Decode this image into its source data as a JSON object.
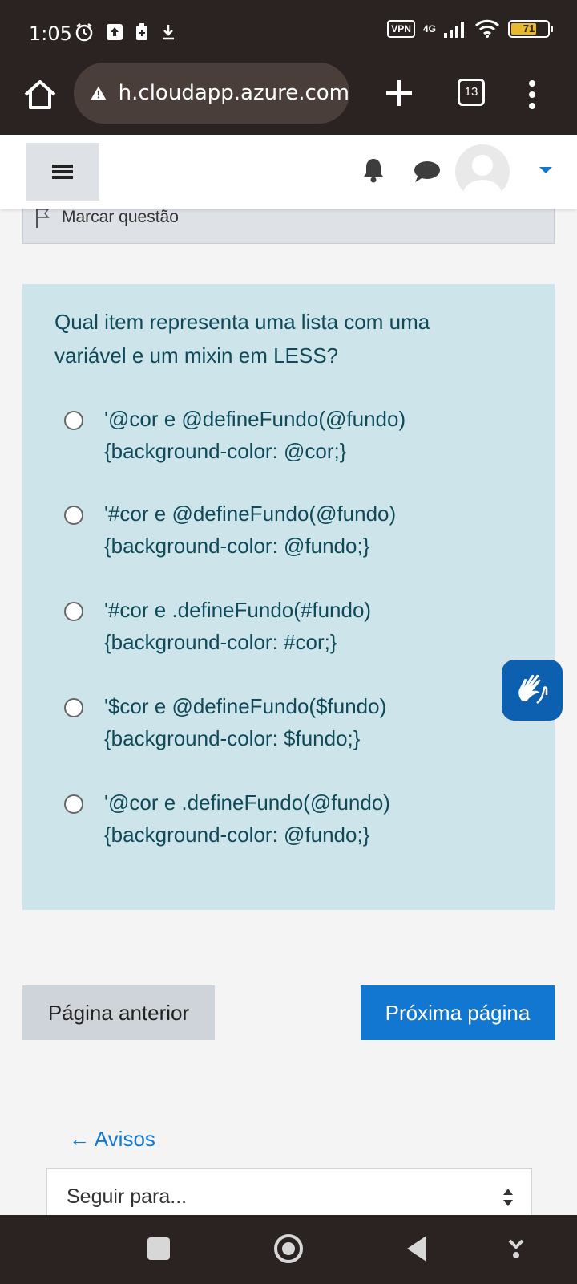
{
  "status_bar": {
    "time": "1:05",
    "vpn": "VPN",
    "network": "4G",
    "battery": "71",
    "battery_level": 0.71
  },
  "browser": {
    "url": "h.cloudapp.azure.com",
    "tab_count": "13"
  },
  "moodle": {
    "flag_label": "Marcar questão",
    "question": "Qual item representa uma lista com uma variável e um mixin em LESS?",
    "options": [
      {
        "text": "'@cor e @defineFundo(@fundo)\n{background-color: @cor;}"
      },
      {
        "text": "'#cor e @defineFundo(@fundo)\n{background-color: @fundo;}"
      },
      {
        "text": "'#cor e .defineFundo(#fundo)\n{background-color: #cor;}"
      },
      {
        "text": "'$cor e @defineFundo($fundo)\n{background-color: $fundo;}"
      },
      {
        "text": "'@cor e .defineFundo(@fundo)\n{background-color: @fundo;}"
      }
    ],
    "prev_label": "Página anterior",
    "next_label": "Próxima página",
    "back_link": "← Avisos",
    "jump_placeholder": "Seguir para..."
  },
  "colors": {
    "primary": "#1177d1",
    "card_bg": "#cde5ea",
    "question_text": "#0f4a5a",
    "system_bar": "#2b2321"
  },
  "icons": [
    "home-icon",
    "warning-icon",
    "plus-icon",
    "tabs-icon",
    "more-vert-icon",
    "hamburger-icon",
    "bell-icon",
    "chat-icon",
    "avatar-icon",
    "flag-icon",
    "sign-language-icon"
  ]
}
